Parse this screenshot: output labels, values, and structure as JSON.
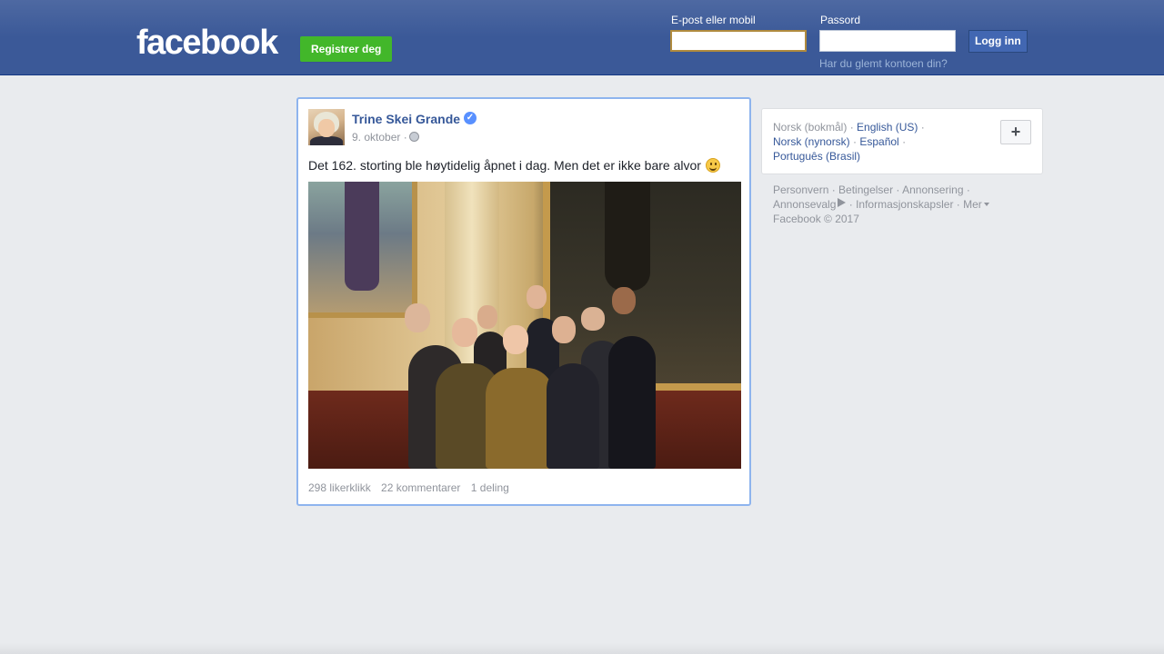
{
  "header": {
    "logo_text": "facebook",
    "register_label": "Registrer deg",
    "email_label": "E-post eller mobil",
    "password_label": "Passord",
    "login_label": "Logg inn",
    "forgot_link": "Har du glemt kontoen din?",
    "email_value": "",
    "password_value": ""
  },
  "post": {
    "author": "Trine Skei Grande",
    "date": "9. oktober",
    "separator": "·",
    "text": "Det 162. storting ble høytidelig åpnet i dag. Men det er ikke bare alvor",
    "likes": "298 likerklikk",
    "comments": "22 kommentarer",
    "shares": "1 deling"
  },
  "languages": {
    "current": "Norsk (bokmål)",
    "options": [
      "English (US)",
      "Norsk (nynorsk)",
      "Español",
      "Português (Brasil)"
    ],
    "add_label": "+"
  },
  "footer": {
    "links": [
      "Personvern",
      "Betingelser",
      "Annonsering",
      "Annonsevalg",
      "Informasjonskapsler",
      "Mer"
    ],
    "copyright": "Facebook © 2017"
  },
  "colors": {
    "brand_blue": "#3b5998",
    "register_green": "#42b72a",
    "link_blue": "#365899",
    "verified_blue": "#5890ff"
  }
}
